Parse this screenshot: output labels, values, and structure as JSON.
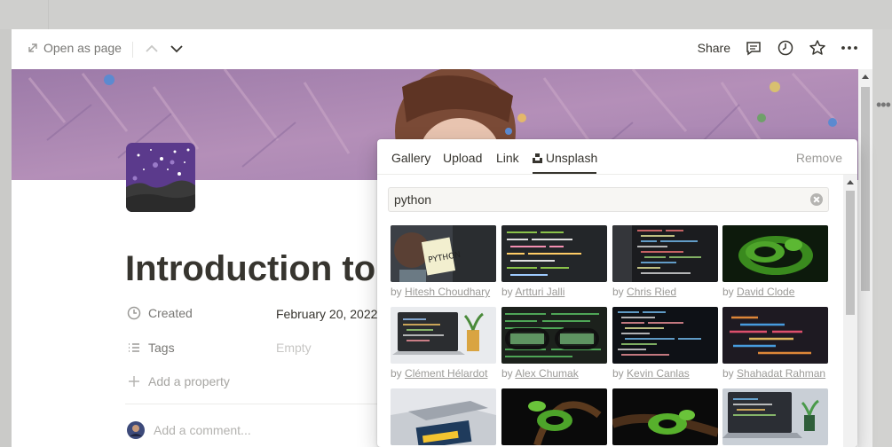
{
  "header": {
    "open_as_page": "Open as page",
    "share": "Share"
  },
  "page": {
    "title": "Introduction to",
    "properties": [
      {
        "label": "Created",
        "value": "February 20, 2022",
        "icon": "clock-icon"
      },
      {
        "label": "Tags",
        "value": "Empty",
        "icon": "list-icon"
      }
    ],
    "add_property": "Add a property",
    "comment_placeholder": "Add a comment..."
  },
  "cover_picker": {
    "tabs": [
      "Gallery",
      "Upload",
      "Link",
      "Unsplash"
    ],
    "active_tab": "Unsplash",
    "remove": "Remove",
    "search_value": "python",
    "credit_prefix": "by",
    "photos": [
      {
        "author": "Hitesh Choudhary"
      },
      {
        "author": "Artturi Jalli"
      },
      {
        "author": "Chris Ried"
      },
      {
        "author": "David Clode"
      },
      {
        "author": "Clément Hélardot"
      },
      {
        "author": "Alex Chumak"
      },
      {
        "author": "Kevin Canlas"
      },
      {
        "author": "Shahadat Rahman"
      },
      {
        "author": ""
      },
      {
        "author": ""
      },
      {
        "author": ""
      },
      {
        "author": ""
      }
    ]
  },
  "colors": {
    "text": "#37352f",
    "muted": "#787774",
    "light": "#9b9a97",
    "page_icon": "#5b3a8c"
  }
}
